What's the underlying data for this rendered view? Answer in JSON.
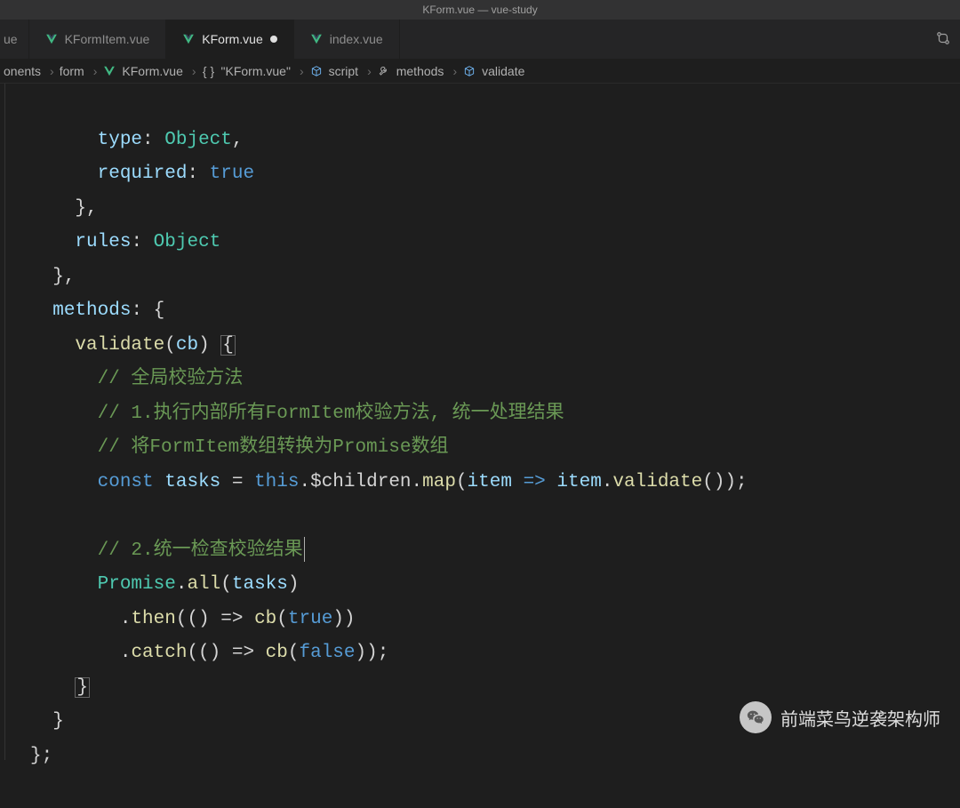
{
  "titlebar": "KForm.vue — vue-study",
  "tabs": [
    {
      "label": "ue",
      "active": false,
      "partial": true,
      "icon": "vue"
    },
    {
      "label": "KFormItem.vue",
      "active": false,
      "icon": "vue"
    },
    {
      "label": "KForm.vue",
      "active": true,
      "icon": "vue",
      "dirty": true
    },
    {
      "label": "index.vue",
      "active": false,
      "icon": "vue"
    }
  ],
  "breadcrumbs": {
    "items": [
      {
        "text": "onents",
        "icon": ""
      },
      {
        "text": "form",
        "icon": ""
      },
      {
        "text": "KForm.vue",
        "icon": "vue"
      },
      {
        "text": "\"KForm.vue\"",
        "icon": "braces"
      },
      {
        "text": "script",
        "icon": "cube"
      },
      {
        "text": "methods",
        "icon": "wrench"
      },
      {
        "text": "validate",
        "icon": "cube"
      }
    ]
  },
  "code": {
    "l1": {
      "a": "type",
      "b": ": ",
      "c": "Object",
      "d": ","
    },
    "l2": {
      "a": "required",
      "b": ": ",
      "c": "true"
    },
    "l3": "},",
    "l4": {
      "a": "rules",
      "b": ": ",
      "c": "Object"
    },
    "l5": "},",
    "l6": {
      "a": "methods",
      "b": ": {",
      "lead": "  "
    },
    "l7": {
      "a": "validate",
      "b": "(",
      "c": "cb",
      "d": ") ",
      "e": "{"
    },
    "c1": "// 全局校验方法",
    "c2": "// 1.执行内部所有FormItem校验方法, 统一处理结果",
    "c3": "// 将FormItem数组转换为Promise数组",
    "l8": {
      "kw": "const",
      "name": "tasks",
      "eq": " = ",
      "th": "this",
      "m1": ".$children.",
      "fn1": "map",
      "p1": "(",
      "it": "item",
      "ar": " => ",
      "it2": "item",
      "dot": ".",
      "fn2": "validate",
      "p2": "());"
    },
    "c4": "// 2.统一检查校验结果",
    "l9": {
      "a": "Promise",
      "b": ".",
      "c": "all",
      "d": "(",
      "e": "tasks",
      "f": ")"
    },
    "l10": {
      "a": ".",
      "b": "then",
      "c": "(() => ",
      "d": "cb",
      "e": "(",
      "f": "true",
      "g": "))"
    },
    "l11": {
      "a": ".",
      "b": "catch",
      "c": "(() => ",
      "d": "cb",
      "e": "(",
      "f": "false",
      "g": "));"
    },
    "l12": "}",
    "l13": "}",
    "l14": "};"
  },
  "watermark": "前端菜鸟逆袭架构师"
}
